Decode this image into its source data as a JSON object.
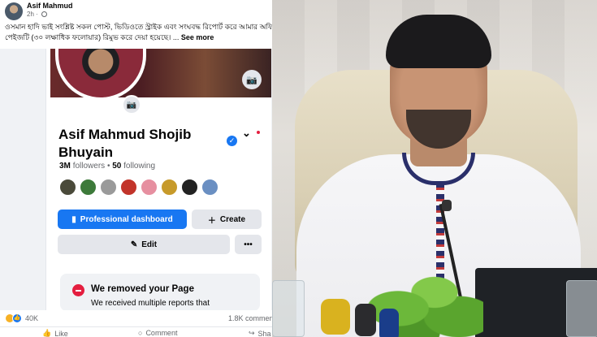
{
  "post": {
    "author": "Asif Mahmud",
    "time": "2h",
    "more": "•••",
    "caption": "ওসমান হাদি ভাই সংশ্লিষ্ট সকল পোস্ট, ভিডিওতে স্ট্রাইক এবং সংঘবদ্ধ রিপোর্ট করে আমার অফিশিয়াল পেইজটি (৩০ লক্ষাধিক ফলোয়ার) রিমুভ করে দেয়া হয়েছে। ...",
    "see_more": "See more",
    "reaction_count": "40K",
    "comments_count": "1.8K commen",
    "actions": {
      "like": "Like",
      "comment": "Comment",
      "share": "Sha"
    }
  },
  "profile": {
    "name": "Asif Mahmud Shojib Bhuyain",
    "followers_num": "3M",
    "followers_label": "followers",
    "dot": "•",
    "following_num": "50",
    "following_label": "following",
    "buttons": {
      "professional": "Professional dashboard",
      "create": "Create",
      "edit": "Edit",
      "more": "•••"
    },
    "removed_title": "We removed your Page",
    "removed_text": "We received multiple reports that",
    "friend_colors": [
      "#4a4a3a",
      "#3d7a3a",
      "#9a9a9a",
      "#c2342a",
      "#e68fa0",
      "#c79a2a",
      "#222222",
      "#6a8fc2"
    ]
  },
  "colors": {
    "facebook_blue": "#1877f2",
    "alert_red": "#e41e3f"
  }
}
